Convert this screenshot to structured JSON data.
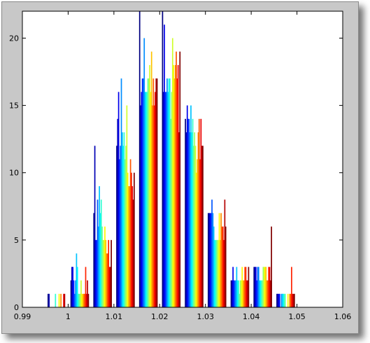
{
  "chart_data": {
    "type": "bar",
    "title": "",
    "xlabel": "",
    "ylabel": "",
    "xlim": [
      0.99,
      1.06
    ],
    "ylim": [
      0,
      22
    ],
    "grid": false,
    "colormap": "jet",
    "xticks": [
      "0.99",
      "1",
      "1.01",
      "1.02",
      "1.03",
      "1.04",
      "1.05",
      "1.06"
    ],
    "yticks": [
      "0",
      "5",
      "10",
      "15",
      "20"
    ],
    "background": "#ffffff",
    "frame_color": "#c8c8c8",
    "bin_centers": [
      0.9975,
      1.0025,
      1.0075,
      1.0125,
      1.0175,
      1.0225,
      1.0275,
      1.0325,
      1.0375,
      1.0425,
      1.0475
    ],
    "series_count": 20,
    "counts_by_bin": [
      [
        1,
        1,
        0,
        0,
        0,
        0,
        0,
        0,
        1,
        0,
        0,
        0,
        1,
        0,
        1,
        0,
        0,
        1,
        1,
        0
      ],
      [
        2,
        3,
        3,
        2,
        1,
        2,
        4,
        3,
        1,
        1,
        1,
        2,
        1,
        1,
        1,
        1,
        3,
        1,
        2,
        1
      ],
      [
        7,
        12,
        5,
        5,
        8,
        6,
        9,
        7,
        8,
        6,
        5,
        5,
        6,
        5,
        4,
        4,
        5,
        3,
        3,
        5
      ],
      [
        12,
        14,
        16,
        11,
        12,
        17,
        13,
        12,
        13,
        11,
        12,
        15,
        10,
        9,
        9,
        11,
        10,
        9,
        8,
        10
      ],
      [
        22,
        15,
        16,
        17,
        17,
        20,
        16,
        16,
        16,
        17,
        17,
        18,
        16,
        19,
        15,
        17,
        15,
        16,
        17,
        17
      ],
      [
        22,
        16,
        21,
        16,
        16,
        17,
        16,
        17,
        17,
        14,
        16,
        20,
        18,
        17,
        18,
        19,
        17,
        18,
        13,
        19
      ],
      [
        14,
        13,
        15,
        14,
        14,
        13,
        15,
        13,
        14,
        12,
        13,
        12,
        10,
        11,
        13,
        14,
        11,
        14,
        12,
        12
      ],
      [
        7,
        7,
        7,
        7,
        8,
        7,
        6,
        5,
        5,
        5,
        5,
        5,
        7,
        5,
        7,
        6,
        6,
        5,
        8,
        6
      ],
      [
        2,
        2,
        3,
        2,
        2,
        2,
        3,
        2,
        2,
        1,
        2,
        2,
        3,
        2,
        2,
        3,
        3,
        2,
        2,
        3
      ],
      [
        3,
        3,
        3,
        2,
        3,
        3,
        2,
        2,
        2,
        2,
        3,
        3,
        3,
        3,
        2,
        2,
        3,
        3,
        2,
        6
      ],
      [
        1,
        1,
        1,
        1,
        0,
        1,
        1,
        1,
        1,
        1,
        0,
        0,
        1,
        0,
        1,
        1,
        3,
        1,
        1,
        1
      ]
    ]
  }
}
